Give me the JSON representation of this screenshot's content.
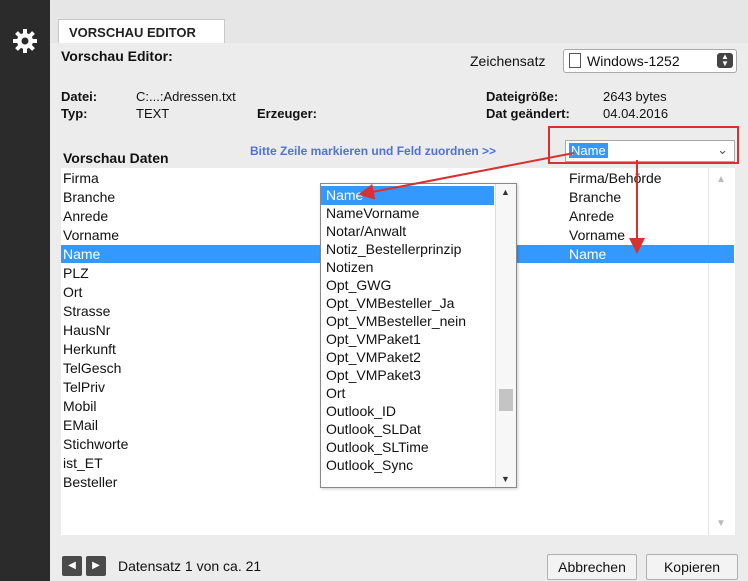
{
  "tab": {
    "label": "VORSCHAU EDITOR"
  },
  "header": {
    "title": "Vorschau Editor:",
    "charset_label": "Zeichensatz",
    "charset_value": "Windows-1252"
  },
  "file_info": {
    "datei_label": "Datei:",
    "datei_value": "C:...:Adressen.txt",
    "typ_label": "Typ:",
    "typ_value": "TEXT",
    "erzeuger_label": "Erzeuger:",
    "dateigroesse_label": "Dateigröße:",
    "dateigroesse_value": "2643 bytes",
    "datgeaendert_label": "Dat geändert:",
    "datgeaendert_value": "04.04.2016"
  },
  "preview": {
    "heading": "Vorschau Daten",
    "hint": "Bitte Zeile markieren und Feld zuordnen >>",
    "field_select_value": "Name",
    "left_rows": [
      "Firma",
      "Branche",
      "Anrede",
      "Vorname",
      "Name",
      "PLZ",
      "Ort",
      "Strasse",
      "HausNr",
      "Herkunft",
      "TelGesch",
      "TelPriv",
      "Mobil",
      "EMail",
      "Stichworte",
      "ist_ET",
      "Besteller"
    ],
    "right_rows": [
      "Firma/Behörde",
      "Branche",
      "Anrede",
      "Vorname",
      "Name"
    ],
    "selected_row": "Name"
  },
  "dropdown": {
    "options": [
      "Name",
      "NameVorname",
      "Notar/Anwalt",
      "Notiz_Bestellerprinzip",
      "Notizen",
      "Opt_GWG",
      "Opt_VMBesteller_Ja",
      "Opt_VMBesteller_nein",
      "Opt_VMPaket1",
      "Opt_VMPaket2",
      "Opt_VMPaket3",
      "Ort",
      "Outlook_ID",
      "Outlook_SLDat",
      "Outlook_SLTime",
      "Outlook_Sync"
    ],
    "selected": "Name"
  },
  "footer": {
    "record_text": "Datensatz 1 von ca. 21",
    "cancel_label": "Abbrechen",
    "copy_label": "Kopieren"
  },
  "colors": {
    "selection": "#3399ff",
    "annotation": "#d93030",
    "hint": "#4f72d6"
  },
  "icons": [
    "gear-icon",
    "document-icon",
    "spinner-icon",
    "chevron-down-icon",
    "prev-icon",
    "next-icon"
  ]
}
